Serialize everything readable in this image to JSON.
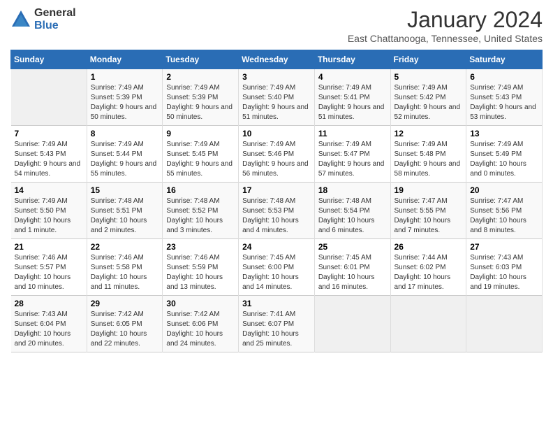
{
  "logo": {
    "general": "General",
    "blue": "Blue"
  },
  "header": {
    "title": "January 2024",
    "subtitle": "East Chattanooga, Tennessee, United States"
  },
  "weekdays": [
    "Sunday",
    "Monday",
    "Tuesday",
    "Wednesday",
    "Thursday",
    "Friday",
    "Saturday"
  ],
  "weeks": [
    [
      {
        "day": "",
        "empty": true
      },
      {
        "day": "1",
        "sunrise": "7:49 AM",
        "sunset": "5:39 PM",
        "daylight": "9 hours and 50 minutes."
      },
      {
        "day": "2",
        "sunrise": "7:49 AM",
        "sunset": "5:39 PM",
        "daylight": "9 hours and 50 minutes."
      },
      {
        "day": "3",
        "sunrise": "7:49 AM",
        "sunset": "5:40 PM",
        "daylight": "9 hours and 51 minutes."
      },
      {
        "day": "4",
        "sunrise": "7:49 AM",
        "sunset": "5:41 PM",
        "daylight": "9 hours and 51 minutes."
      },
      {
        "day": "5",
        "sunrise": "7:49 AM",
        "sunset": "5:42 PM",
        "daylight": "9 hours and 52 minutes."
      },
      {
        "day": "6",
        "sunrise": "7:49 AM",
        "sunset": "5:43 PM",
        "daylight": "9 hours and 53 minutes."
      }
    ],
    [
      {
        "day": "7",
        "sunrise": "7:49 AM",
        "sunset": "5:43 PM",
        "daylight": "9 hours and 54 minutes."
      },
      {
        "day": "8",
        "sunrise": "7:49 AM",
        "sunset": "5:44 PM",
        "daylight": "9 hours and 55 minutes."
      },
      {
        "day": "9",
        "sunrise": "7:49 AM",
        "sunset": "5:45 PM",
        "daylight": "9 hours and 55 minutes."
      },
      {
        "day": "10",
        "sunrise": "7:49 AM",
        "sunset": "5:46 PM",
        "daylight": "9 hours and 56 minutes."
      },
      {
        "day": "11",
        "sunrise": "7:49 AM",
        "sunset": "5:47 PM",
        "daylight": "9 hours and 57 minutes."
      },
      {
        "day": "12",
        "sunrise": "7:49 AM",
        "sunset": "5:48 PM",
        "daylight": "9 hours and 58 minutes."
      },
      {
        "day": "13",
        "sunrise": "7:49 AM",
        "sunset": "5:49 PM",
        "daylight": "10 hours and 0 minutes."
      }
    ],
    [
      {
        "day": "14",
        "sunrise": "7:49 AM",
        "sunset": "5:50 PM",
        "daylight": "10 hours and 1 minute."
      },
      {
        "day": "15",
        "sunrise": "7:48 AM",
        "sunset": "5:51 PM",
        "daylight": "10 hours and 2 minutes."
      },
      {
        "day": "16",
        "sunrise": "7:48 AM",
        "sunset": "5:52 PM",
        "daylight": "10 hours and 3 minutes."
      },
      {
        "day": "17",
        "sunrise": "7:48 AM",
        "sunset": "5:53 PM",
        "daylight": "10 hours and 4 minutes."
      },
      {
        "day": "18",
        "sunrise": "7:48 AM",
        "sunset": "5:54 PM",
        "daylight": "10 hours and 6 minutes."
      },
      {
        "day": "19",
        "sunrise": "7:47 AM",
        "sunset": "5:55 PM",
        "daylight": "10 hours and 7 minutes."
      },
      {
        "day": "20",
        "sunrise": "7:47 AM",
        "sunset": "5:56 PM",
        "daylight": "10 hours and 8 minutes."
      }
    ],
    [
      {
        "day": "21",
        "sunrise": "7:46 AM",
        "sunset": "5:57 PM",
        "daylight": "10 hours and 10 minutes."
      },
      {
        "day": "22",
        "sunrise": "7:46 AM",
        "sunset": "5:58 PM",
        "daylight": "10 hours and 11 minutes."
      },
      {
        "day": "23",
        "sunrise": "7:46 AM",
        "sunset": "5:59 PM",
        "daylight": "10 hours and 13 minutes."
      },
      {
        "day": "24",
        "sunrise": "7:45 AM",
        "sunset": "6:00 PM",
        "daylight": "10 hours and 14 minutes."
      },
      {
        "day": "25",
        "sunrise": "7:45 AM",
        "sunset": "6:01 PM",
        "daylight": "10 hours and 16 minutes."
      },
      {
        "day": "26",
        "sunrise": "7:44 AM",
        "sunset": "6:02 PM",
        "daylight": "10 hours and 17 minutes."
      },
      {
        "day": "27",
        "sunrise": "7:43 AM",
        "sunset": "6:03 PM",
        "daylight": "10 hours and 19 minutes."
      }
    ],
    [
      {
        "day": "28",
        "sunrise": "7:43 AM",
        "sunset": "6:04 PM",
        "daylight": "10 hours and 20 minutes."
      },
      {
        "day": "29",
        "sunrise": "7:42 AM",
        "sunset": "6:05 PM",
        "daylight": "10 hours and 22 minutes."
      },
      {
        "day": "30",
        "sunrise": "7:42 AM",
        "sunset": "6:06 PM",
        "daylight": "10 hours and 24 minutes."
      },
      {
        "day": "31",
        "sunrise": "7:41 AM",
        "sunset": "6:07 PM",
        "daylight": "10 hours and 25 minutes."
      },
      {
        "day": "",
        "empty": true
      },
      {
        "day": "",
        "empty": true
      },
      {
        "day": "",
        "empty": true
      }
    ]
  ]
}
